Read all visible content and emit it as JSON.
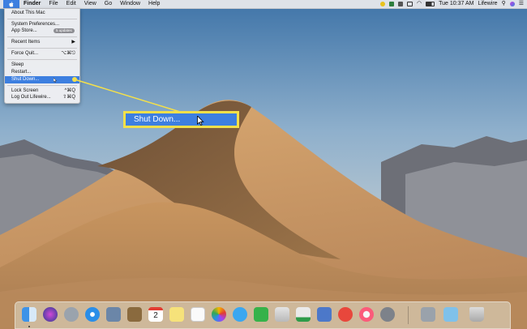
{
  "menubar": {
    "apple_icon": "apple-icon",
    "app_name": "Finder",
    "menus": [
      "File",
      "Edit",
      "View",
      "Go",
      "Window",
      "Help"
    ],
    "clock": "Tue 10:37 AM",
    "user": "Lifewire",
    "tray_icons": [
      "norton-icon",
      "shield-icon",
      "app-icon",
      "airplay-icon",
      "wifi-icon",
      "battery-icon",
      "search-icon",
      "siri-icon",
      "notification-center-icon"
    ]
  },
  "apple_menu": {
    "about": "About This Mac",
    "system_preferences": "System Preferences...",
    "app_store": "App Store...",
    "app_store_badge": "5 updates",
    "recent_items": "Recent Items",
    "recent_items_arrow": "▶",
    "force_quit": "Force Quit...",
    "force_quit_shortcut": "⌥⌘⎋",
    "sleep": "Sleep",
    "restart": "Restart...",
    "shut_down": "Shut Down...",
    "lock_screen": "Lock Screen",
    "lock_screen_shortcut": "^⌘Q",
    "log_out": "Log Out Lifewire...",
    "log_out_shortcut": "⇧⌘Q"
  },
  "callout": {
    "label": "Shut Down...",
    "color": "#f4e04a"
  },
  "colors": {
    "highlight": "#3d7fe0",
    "callout": "#f4e04a"
  },
  "dock": {
    "items": [
      "finder-icon",
      "siri-icon",
      "launchpad-icon",
      "safari-icon",
      "preview-icon",
      "notes-book-icon",
      "calendar-icon",
      "stickies-icon",
      "reminders-icon",
      "photos-icon",
      "messages-icon",
      "facetime-icon",
      "numbers-icon",
      "keynote-icon",
      "news-icon",
      "music-icon",
      "system-preferences-icon",
      "printer-icon",
      "downloads-folder-icon",
      "trash-icon"
    ],
    "calendar_day": "2"
  }
}
